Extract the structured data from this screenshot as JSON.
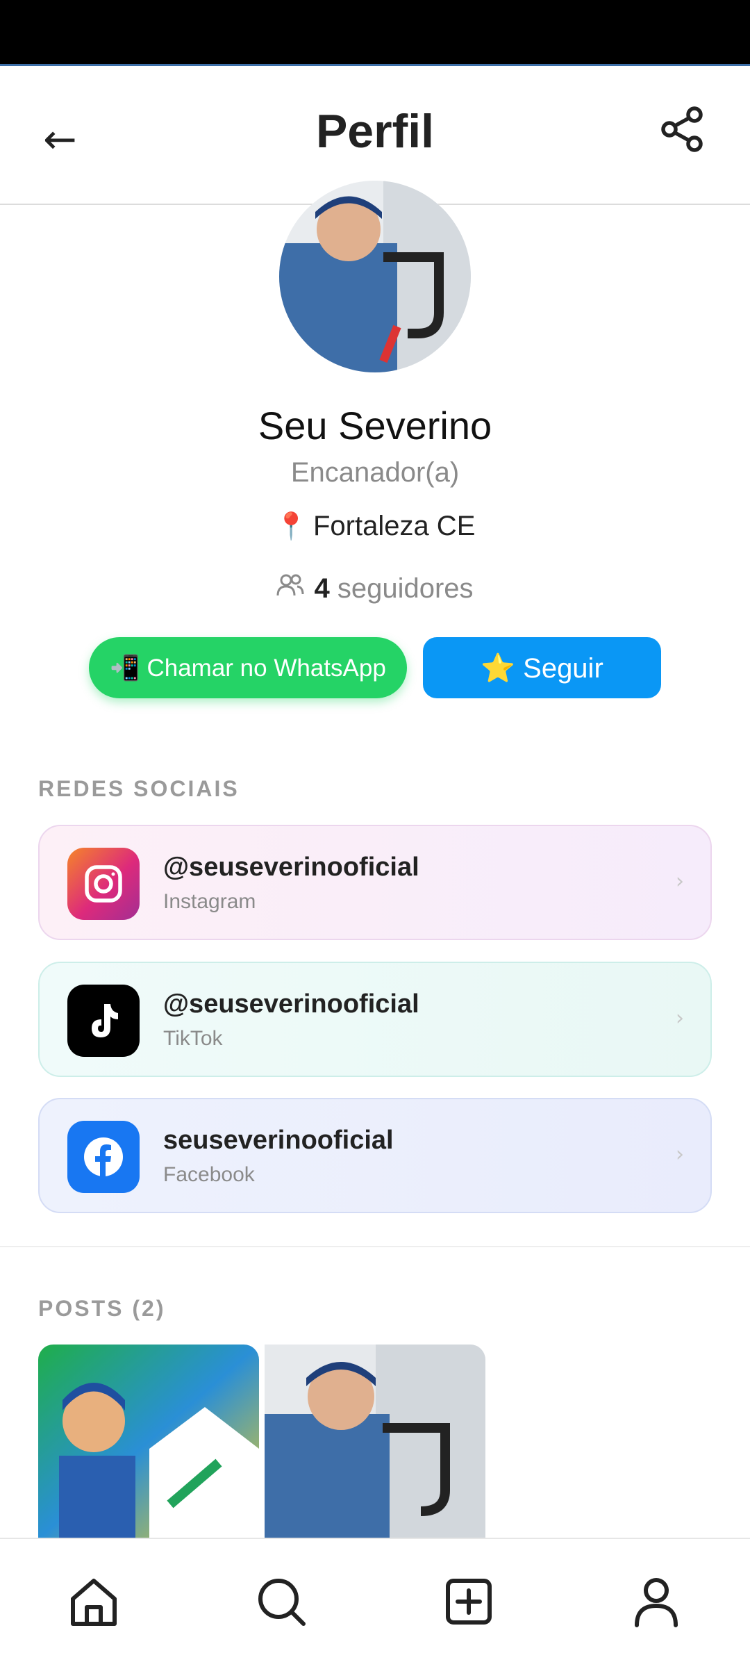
{
  "header": {
    "title": "Perfil",
    "back_icon": "←"
  },
  "profile": {
    "name": "Seu Severino",
    "role": "Encanador(a)",
    "location_icon": "📍",
    "location": "Fortaleza CE",
    "followers_count": "4",
    "followers_label": "seguidores"
  },
  "actions": {
    "whatsapp_label": "📲 Chamar no WhatsApp",
    "follow_label": "⭐ Seguir"
  },
  "social": {
    "section_label": "REDES SOCIAIS",
    "items": [
      {
        "handle": "@seuseverinooficial",
        "platform": "Instagram",
        "icon": "instagram-icon"
      },
      {
        "handle": "@seuseverinooficial",
        "platform": "TikTok",
        "icon": "tiktok-icon"
      },
      {
        "handle": "seuseverinooficial",
        "platform": "Facebook",
        "icon": "facebook-icon"
      }
    ],
    "chevron": "›"
  },
  "posts": {
    "section_label": "POSTS (2)"
  },
  "colors": {
    "whatsapp": "#25d366",
    "follow": "#0a97f5",
    "instagram": "#dd2a7b",
    "tiktok": "#000000",
    "facebook": "#1877f2"
  },
  "bottom_nav": [
    "home-icon",
    "search-icon",
    "add-post-icon",
    "profile-icon"
  ]
}
